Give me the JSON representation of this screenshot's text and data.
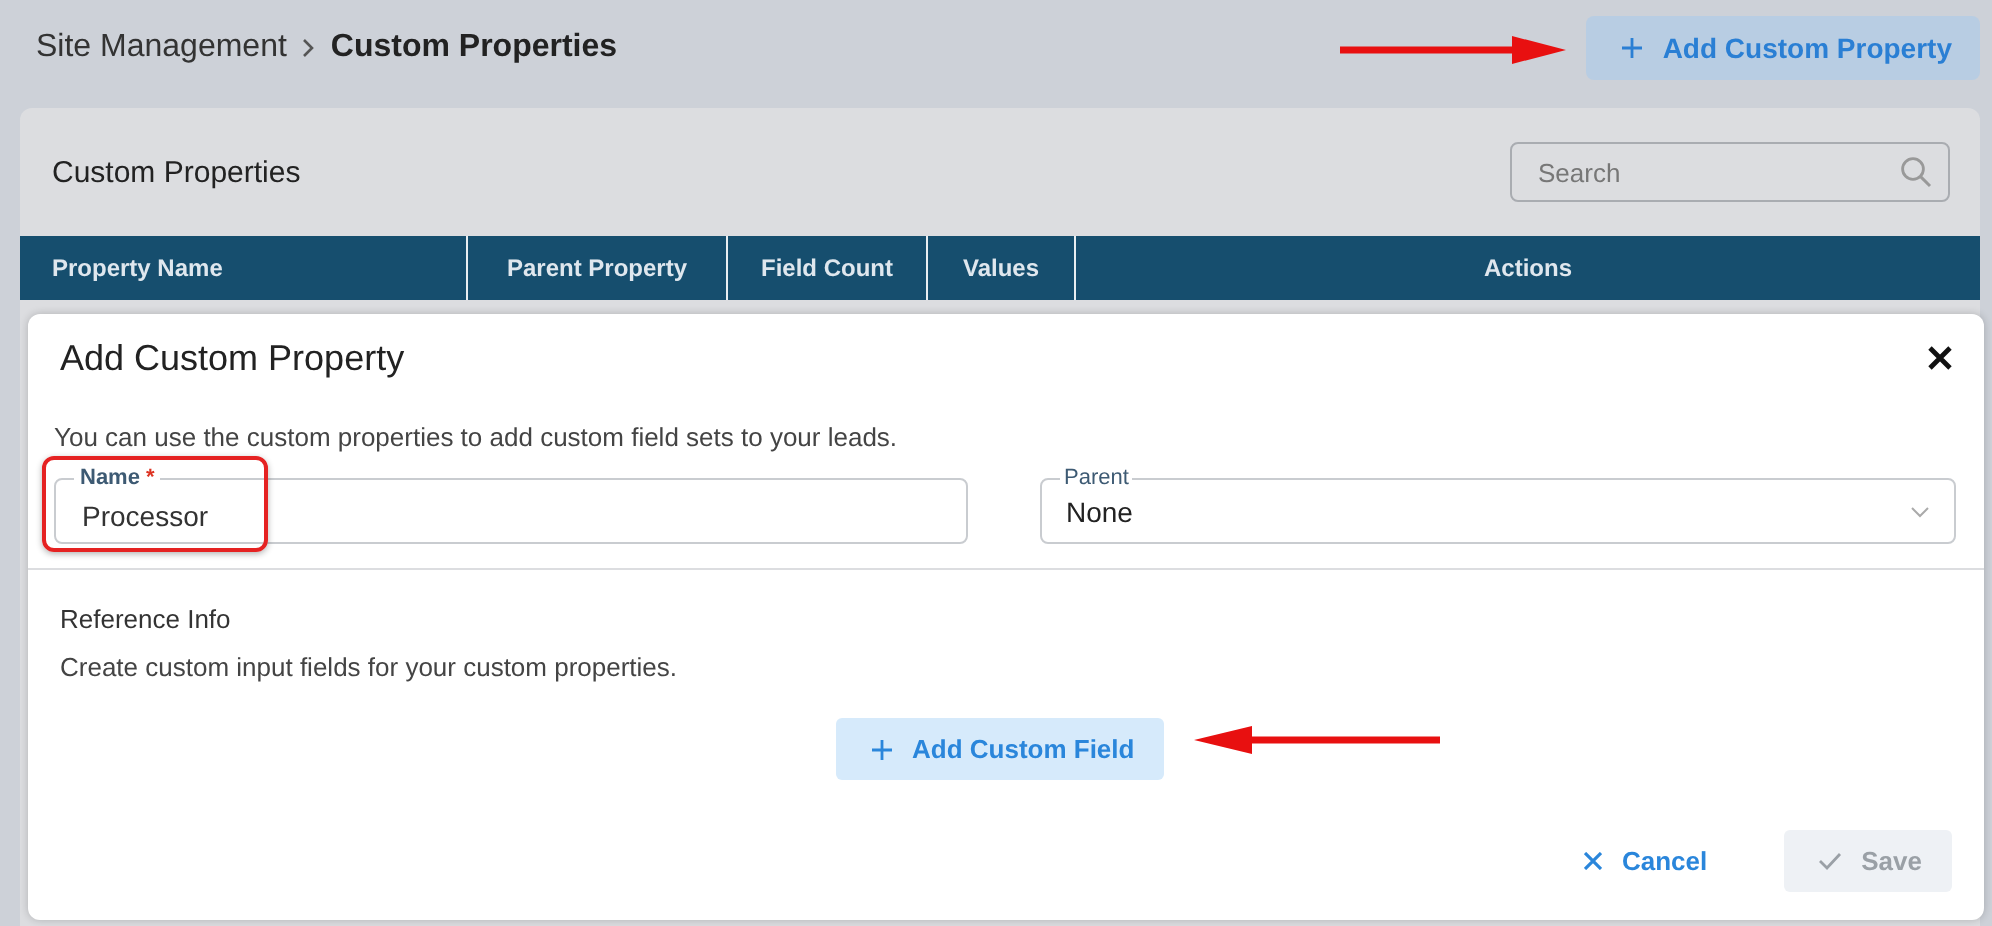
{
  "breadcrumb": [
    {
      "label": "Site Management",
      "current": false
    },
    {
      "label": "Custom Properties",
      "current": true
    }
  ],
  "header_button": {
    "label": "Add Custom Property"
  },
  "panel": {
    "title": "Custom Properties",
    "search": {
      "placeholder": "Search"
    },
    "table": {
      "columns": [
        "Property Name",
        "Parent Property",
        "Field Count",
        "Values",
        "Actions"
      ]
    }
  },
  "dialog": {
    "title": "Add Custom Property",
    "description": "You can use the custom properties to add custom field sets to your leads.",
    "fields": [
      {
        "kind": "text",
        "label": "Name",
        "required_mark": "*",
        "value": "Processor",
        "highlighted": true
      },
      {
        "kind": "select",
        "label": "Parent",
        "value": "None",
        "highlighted": false
      }
    ],
    "section": {
      "title": "Reference Info",
      "description": "Create custom input fields for your custom properties."
    },
    "add_field_button": {
      "label": "Add Custom Field"
    },
    "actions": [
      {
        "kind": "cancel",
        "label": "Cancel",
        "disabled": false
      },
      {
        "kind": "save",
        "label": "Save",
        "disabled": true
      }
    ]
  }
}
